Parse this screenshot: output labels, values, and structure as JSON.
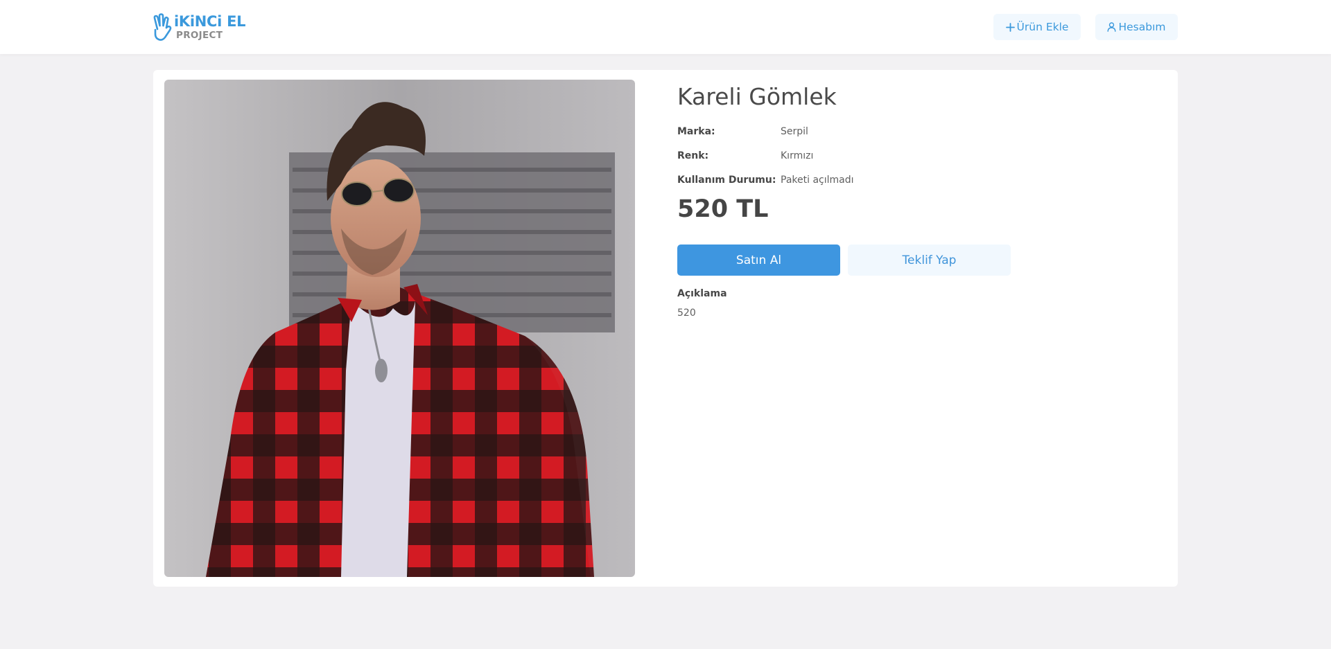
{
  "brand": {
    "line1": "iKiNCi EL",
    "line2": "PROJECT",
    "icon": "waving-hand-logo-icon",
    "accent_color": "#3b99dc"
  },
  "header": {
    "add_product": {
      "icon": "plus-icon",
      "label": "Ürün Ekle"
    },
    "account": {
      "icon": "user-icon",
      "label": "Hesabım"
    }
  },
  "product": {
    "title": "Kareli Gömlek",
    "image": "photo-man-red-black-plaid-shirt-sunglasses",
    "specs": [
      {
        "label": "Marka:",
        "value": "Serpil"
      },
      {
        "label": "Renk:",
        "value": "Kırmızı"
      },
      {
        "label": "Kullanım Durumu:",
        "value": "Paketi açılmadı"
      }
    ],
    "price": "520 TL",
    "buy_label": "Satın Al",
    "offer_label": "Teklif Yap",
    "description_heading": "Açıklama",
    "description": "520"
  },
  "colors": {
    "primary": "#3e96e0",
    "primary_light": "#f1f8fe",
    "background": "#f2f1f3"
  }
}
